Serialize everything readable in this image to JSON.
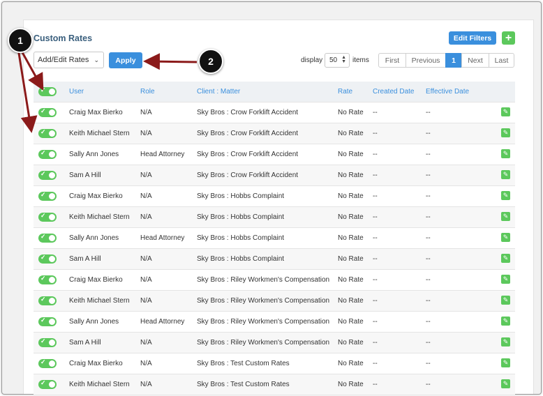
{
  "page": {
    "title": "Custom Rates",
    "edit_filters_label": "Edit Filters",
    "add_label": "+"
  },
  "toolbar": {
    "action_select_value": "Add/Edit Rates",
    "apply_label": "Apply",
    "display_label": "display",
    "display_value": "50",
    "items_label": "items"
  },
  "pagination": {
    "first": "First",
    "previous": "Previous",
    "current": "1",
    "next": "Next",
    "last": "Last"
  },
  "table": {
    "headers": {
      "user": "User",
      "role": "Role",
      "client_matter": "Client : Matter",
      "rate": "Rate",
      "created_date": "Created Date",
      "effective_date": "Effective Date"
    },
    "rows": [
      {
        "user": "Craig Max Bierko",
        "role": "N/A",
        "client_matter": "Sky Bros : Crow Forklift Accident",
        "rate": "No Rate",
        "created": "--",
        "effective": "--"
      },
      {
        "user": "Keith Michael Stern",
        "role": "N/A",
        "client_matter": "Sky Bros : Crow Forklift Accident",
        "rate": "No Rate",
        "created": "--",
        "effective": "--"
      },
      {
        "user": "Sally Ann Jones",
        "role": "Head Attorney",
        "client_matter": "Sky Bros : Crow Forklift Accident",
        "rate": "No Rate",
        "created": "--",
        "effective": "--"
      },
      {
        "user": "Sam A Hill",
        "role": "N/A",
        "client_matter": "Sky Bros : Crow Forklift Accident",
        "rate": "No Rate",
        "created": "--",
        "effective": "--"
      },
      {
        "user": "Craig Max Bierko",
        "role": "N/A",
        "client_matter": "Sky Bros : Hobbs Complaint",
        "rate": "No Rate",
        "created": "--",
        "effective": "--"
      },
      {
        "user": "Keith Michael Stern",
        "role": "N/A",
        "client_matter": "Sky Bros : Hobbs Complaint",
        "rate": "No Rate",
        "created": "--",
        "effective": "--"
      },
      {
        "user": "Sally Ann Jones",
        "role": "Head Attorney",
        "client_matter": "Sky Bros : Hobbs Complaint",
        "rate": "No Rate",
        "created": "--",
        "effective": "--"
      },
      {
        "user": "Sam A Hill",
        "role": "N/A",
        "client_matter": "Sky Bros : Hobbs Complaint",
        "rate": "No Rate",
        "created": "--",
        "effective": "--"
      },
      {
        "user": "Craig Max Bierko",
        "role": "N/A",
        "client_matter": "Sky Bros : Riley Workmen's Compensation",
        "rate": "No Rate",
        "created": "--",
        "effective": "--"
      },
      {
        "user": "Keith Michael Stern",
        "role": "N/A",
        "client_matter": "Sky Bros : Riley Workmen's Compensation",
        "rate": "No Rate",
        "created": "--",
        "effective": "--"
      },
      {
        "user": "Sally Ann Jones",
        "role": "Head Attorney",
        "client_matter": "Sky Bros : Riley Workmen's Compensation",
        "rate": "No Rate",
        "created": "--",
        "effective": "--"
      },
      {
        "user": "Sam A Hill",
        "role": "N/A",
        "client_matter": "Sky Bros : Riley Workmen's Compensation",
        "rate": "No Rate",
        "created": "--",
        "effective": "--"
      },
      {
        "user": "Craig Max Bierko",
        "role": "N/A",
        "client_matter": "Sky Bros : Test Custom Rates",
        "rate": "No Rate",
        "created": "--",
        "effective": "--"
      },
      {
        "user": "Keith Michael Stern",
        "role": "N/A",
        "client_matter": "Sky Bros : Test Custom Rates",
        "rate": "No Rate",
        "created": "--",
        "effective": "--"
      }
    ]
  },
  "annotations": {
    "badge_1": "1",
    "badge_2": "2",
    "arrow_color": "#8b1a1a"
  },
  "colors": {
    "accent": "#3a8fdd",
    "toggle_on": "#5cc85c",
    "title": "#3a5f7d"
  }
}
